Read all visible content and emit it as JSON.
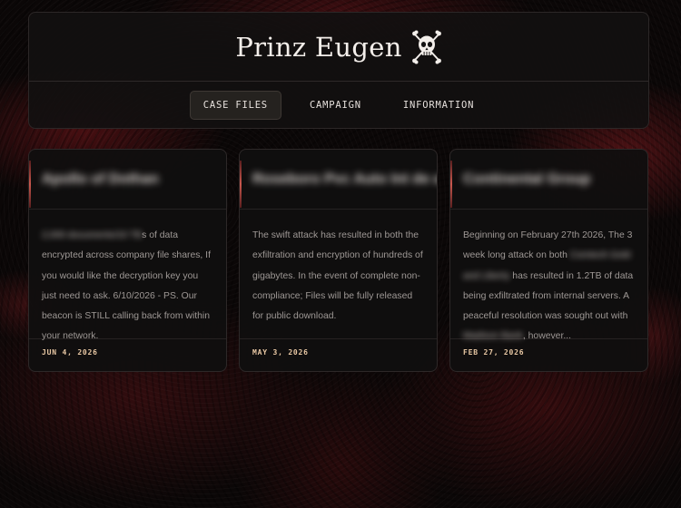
{
  "site": {
    "title": "Prinz Eugen",
    "logo_icon": "skull-crossbones-icon"
  },
  "nav": {
    "items": [
      {
        "label": "CASE FILES",
        "active": true
      },
      {
        "label": "CAMPAIGN",
        "active": false
      },
      {
        "label": "INFORMATION",
        "active": false
      }
    ]
  },
  "cards": [
    {
      "title": "Apollo of Dothan",
      "body": {
        "redacted_lead": "2,000 documents/10 TB",
        "text": "s of data encrypted across company file shares, If you would like the decryption key you just need to ask. 6/10/2026 - PS. Our beacon is STILL calling back from within your network."
      },
      "date": "JUN 4, 2026"
    },
    {
      "title": "Roseboro Pvc Auto Int de arm",
      "body": {
        "text": "The swift attack has resulted in both the exfiltration and encryption of hundreds of gigabytes. In the event of complete non-compliance; Files will be fully released for public download."
      },
      "date": "MAY 3, 2026"
    },
    {
      "title": "Continental Group",
      "body": {
        "text_a": "Beginning on February 27th 2026, The 3 week long attack on both ",
        "redacted_a": "Comtech Gold and Liberty",
        "text_b": " has resulted in 1.2TB of data being exfiltrated from internal servers. A peaceful resolution was sought out with ",
        "redacted_b": "Madison Bank",
        "text_c": ", however..."
      },
      "date": "FEB 27, 2026"
    }
  ]
}
